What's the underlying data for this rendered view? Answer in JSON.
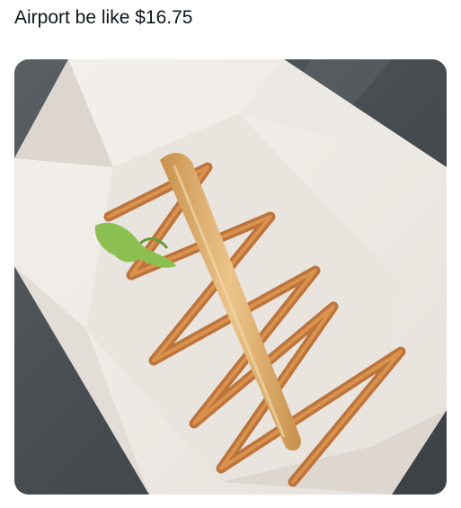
{
  "post": {
    "caption": "Airport be like $16.75"
  },
  "photo": {
    "subject_icon": "food-tray-photo-icon",
    "colors": {
      "table": "#4b5156",
      "tray": "#f1eeea",
      "tray_shadow": "#d9d4ce",
      "fry": "#e0b479",
      "sauce": "#b8682c",
      "garnish": "#8cbf52"
    }
  }
}
